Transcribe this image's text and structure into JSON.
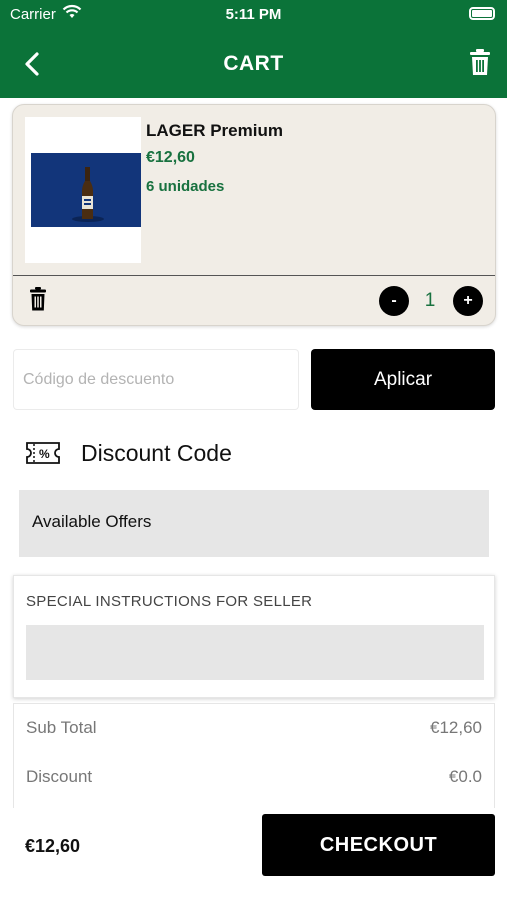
{
  "status_bar": {
    "carrier": "Carrier",
    "time": "5:11 PM"
  },
  "header": {
    "title": "CART"
  },
  "cart_item": {
    "name": "LAGER Premium",
    "price": "€12,60",
    "units": "6 unidades",
    "quantity": "1",
    "minus_label": "-",
    "plus_label": "+"
  },
  "discount": {
    "input_placeholder": "Código de descuento",
    "input_value": "",
    "apply_label": "Aplicar",
    "icon_text": "%",
    "heading": "Discount Code",
    "offers_label": "Available Offers"
  },
  "instructions": {
    "label": "SPECIAL INSTRUCTIONS FOR SELLER"
  },
  "totals": {
    "subtotal_label": "Sub Total",
    "subtotal_value": "€12,60",
    "discount_label": "Discount",
    "discount_value": "€0.0"
  },
  "footer": {
    "total": "€12,60",
    "checkout_label": "CHECKOUT"
  },
  "colors": {
    "header_green": "#0b7339",
    "accent_green": "#18713f",
    "card_bg": "#f1ede6",
    "button_black": "#000000"
  }
}
